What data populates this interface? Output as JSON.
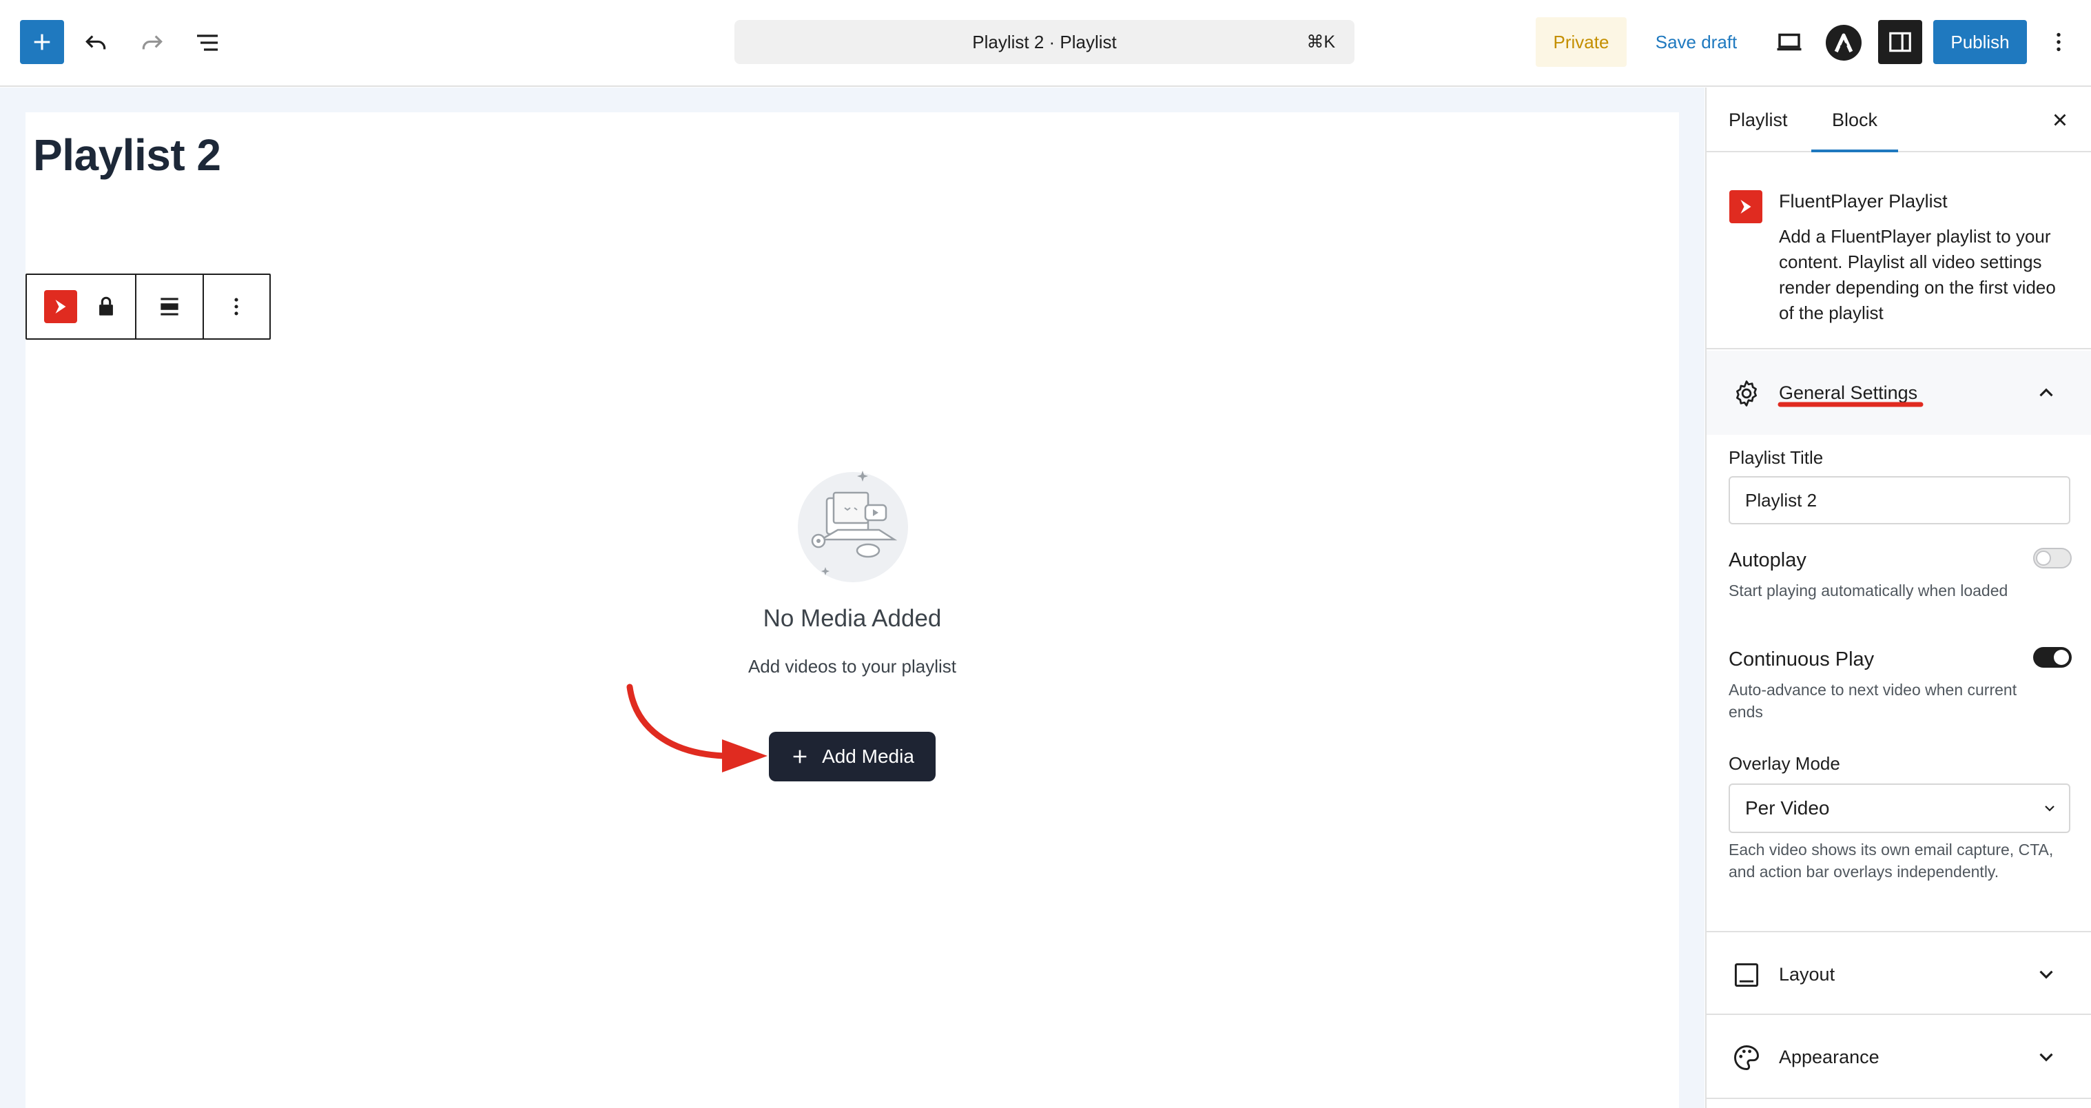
{
  "toolbar": {
    "inserter_icon": "plus-icon",
    "undo_icon": "undo-icon",
    "redo_icon": "redo-icon",
    "listview_icon": "list-view-icon",
    "command_title": "Playlist 2 · Playlist",
    "command_shortcut": "⌘K",
    "private_label": "Private",
    "save_draft_label": "Save draft",
    "preview_icon": "desktop-icon",
    "settings_icon": "sidebar-icon",
    "publish_label": "Publish",
    "more_icon": "kebab-icon"
  },
  "editor": {
    "post_title": "Playlist 2",
    "empty_title": "No Media Added",
    "empty_subtitle": "Add videos to your playlist",
    "add_media_label": "Add Media"
  },
  "sidebar": {
    "tabs": [
      {
        "label": "Playlist",
        "active": false
      },
      {
        "label": "Block",
        "active": true
      }
    ],
    "block": {
      "title": "FluentPlayer Playlist",
      "description": "Add a FluentPlayer playlist to your content. Playlist all video settings render depending on the first video of the playlist"
    },
    "general": {
      "label": "General Settings",
      "playlist_title_label": "Playlist Title",
      "playlist_title_value": "Playlist 2",
      "autoplay_label": "Autoplay",
      "autoplay_on": false,
      "autoplay_help": "Start playing automatically when loaded",
      "continuous_label": "Continuous Play",
      "continuous_on": true,
      "continuous_help": "Auto-advance to next video when current ends",
      "overlay_label": "Overlay Mode",
      "overlay_value": "Per Video",
      "overlay_help": "Each video shows its own email capture, CTA, and action bar overlays independently."
    },
    "layout_label": "Layout",
    "appearance_label": "Appearance"
  },
  "colors": {
    "accent": "#1f79bf",
    "brand_red": "#e02b20",
    "private_text": "#c48f00",
    "private_bg": "#fcf6e4",
    "dark": "#1e1e1e",
    "annotation_red": "#e02b20"
  }
}
